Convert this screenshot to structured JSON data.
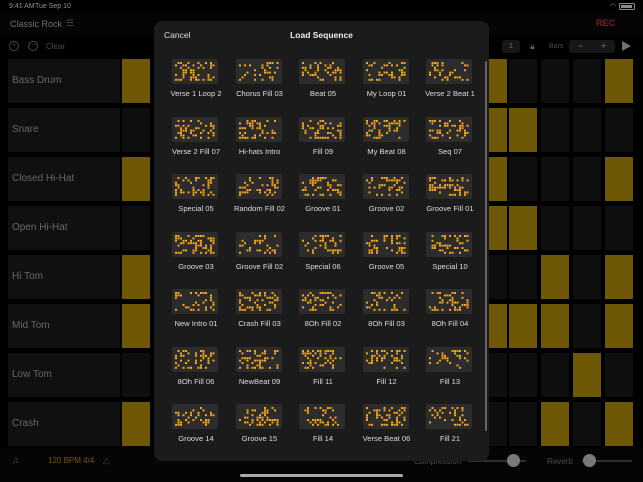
{
  "status_bar": {
    "time": "9:41 AM",
    "date": "Tue Sep 10"
  },
  "header": {
    "song_title": "Classic Rock",
    "rec_label": "REC"
  },
  "toolbar": {
    "clear_label": "Clear",
    "bar_count": "1",
    "bars_label": "Bars",
    "minus": "−",
    "plus": "+"
  },
  "tracks": [
    {
      "label": "Bass Drum",
      "pads": [
        1,
        0,
        0,
        0,
        1
      ],
      "pads_left": [
        1
      ]
    },
    {
      "label": "Snare",
      "pads": [
        1,
        1,
        0,
        0,
        0
      ],
      "pads_left": [
        0
      ]
    },
    {
      "label": "Closed Hi-Hat",
      "pads": [
        1,
        0,
        0,
        0,
        1
      ],
      "pads_left": [
        1
      ]
    },
    {
      "label": "Open Hi-Hat",
      "pads": [
        1,
        1,
        0,
        0,
        0
      ],
      "pads_left": [
        0
      ]
    },
    {
      "label": "Hi Tom",
      "pads": [
        0,
        0,
        1,
        0,
        1
      ],
      "pads_left": [
        1
      ]
    },
    {
      "label": "Mid Tom",
      "pads": [
        1,
        1,
        1,
        0,
        1
      ],
      "pads_left": [
        1
      ]
    },
    {
      "label": "Low Tom",
      "pads": [
        0,
        0,
        0,
        1,
        0
      ],
      "pads_left": [
        0
      ]
    },
    {
      "label": "Crash",
      "pads": [
        0,
        0,
        1,
        0,
        1
      ],
      "pads_left": [
        1
      ]
    }
  ],
  "bottom": {
    "tempo": "120 BPM 4/4",
    "compression_label": "Compression",
    "reverb_label": "Reverb"
  },
  "modal": {
    "cancel_label": "Cancel",
    "title": "Load Sequence",
    "accent": "#f5a516",
    "sequences": [
      "Verse 1 Loop 2",
      "Chorus Fill 03",
      "Beat 05",
      "My Loop 01",
      "Verse 2 Beat 1",
      "Verse 2 Fill 07",
      "Hi-hats Intro",
      "Fill 09",
      "My Beat 08",
      "Seq 07",
      "Special 05",
      "Random Fill 02",
      "Groove 01",
      "Groove 02",
      "Groove Fill 01",
      "Groove 03",
      "Groove Fill 02",
      "Special 06",
      "Groove 05",
      "Special 10",
      "New Intro 01",
      "Crash Fill 03",
      "8Oh Fill 02",
      "8Oh Fill 03",
      "8Oh Fill 04",
      "8Oh Fill 06",
      "NewBeat 09",
      "Fill 11",
      "Fill 12",
      "Fill 13",
      "Groove 14",
      "Groove 15",
      "Fill 14",
      "Verse Beat 06",
      "Fill 21"
    ]
  }
}
